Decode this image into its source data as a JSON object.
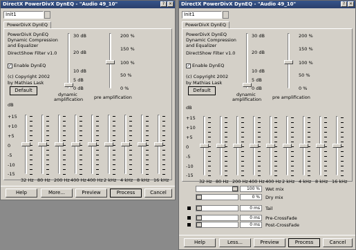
{
  "windows": [
    {
      "title": "DirectX PowerDivX DynEQ - \"Audio 49_10\"",
      "title_buttons": [
        "?",
        "×"
      ],
      "preset": "Init1",
      "tab": "PowerDivX DynEQ",
      "info": [
        "PowerDivX DynEQ",
        "Dynamic Compression",
        "and Equalizer",
        "DirectShow Filter v1.0"
      ],
      "enable_label": "Enable DynEQ",
      "enable_checked": "✓",
      "copyright": "(c) Copyright 2002",
      "author": "by Mathias Lask",
      "default_label": "Default",
      "dyn_scale": [
        "30 dB",
        "20 dB",
        "10 dB",
        "5 dB",
        "0 dB"
      ],
      "dyn_label": [
        "dynamic",
        "amplification"
      ],
      "pre_scale": [
        "200 %",
        "150 %",
        "100 %",
        "50 %",
        "0 %"
      ],
      "pre_label": "pre amplification",
      "eq_db_label": "dB",
      "eq_scale": [
        "+15",
        "+10",
        "+5",
        "0",
        "-5",
        "-10",
        "-15"
      ],
      "bands": [
        "32 Hz",
        "80 Hz",
        "200 Hz",
        "400 Hz",
        "400 Hz",
        "2 kHz",
        "4 kHz",
        "8 kHz",
        "16 kHz"
      ],
      "buttons": [
        "Help",
        "More...",
        "Preview",
        "Process",
        "Cancel"
      ]
    },
    {
      "title": "DirectX PowerDivX DynEQ - \"Audio 49_10\"",
      "title_buttons": [
        "?",
        "×"
      ],
      "preset": "Init1",
      "tab": "PowerDivX DynEQ",
      "info": [
        "PowerDivX DynEQ",
        "Dynamic Compression",
        "and Equalizer",
        "DirectShow Filter v1.0"
      ],
      "enable_label": "Enable DynEQ",
      "enable_checked": "✓",
      "copyright": "(c) Copyright 2002",
      "author": "by Mathias Lask",
      "default_label": "Default",
      "dyn_scale": [
        "30 dB",
        "20 dB",
        "10 dB",
        "5 dB",
        "0 dB"
      ],
      "dyn_label": [
        "dynamic",
        "amplification"
      ],
      "pre_scale": [
        "200 %",
        "150 %",
        "100 %",
        "50 %",
        "0 %"
      ],
      "pre_label": "pre amplification",
      "eq_db_label": "dB",
      "eq_scale": [
        "+15",
        "+10",
        "+5",
        "0",
        "-5",
        "-10",
        "-15"
      ],
      "bands": [
        "32 Hz",
        "80 Hz",
        "200 Hz",
        "400 Hz",
        "400 Hz",
        "2 kHz",
        "4 kHz",
        "8 kHz",
        "16 kHz"
      ],
      "mix_rows": [
        {
          "value": "100 %",
          "label": "Wet mix"
        },
        {
          "value": "0 %",
          "label": "Dry mix"
        }
      ],
      "time_rows": [
        {
          "value": "0 ms",
          "label": "Tail"
        },
        {
          "value": "0 ms",
          "label": "Pre-CrossFade"
        },
        {
          "value": "0 ms",
          "label": "Post-CrossFade"
        }
      ],
      "buttons": [
        "Help",
        "Less...",
        "Preview",
        "Process",
        "Cancel"
      ]
    }
  ]
}
